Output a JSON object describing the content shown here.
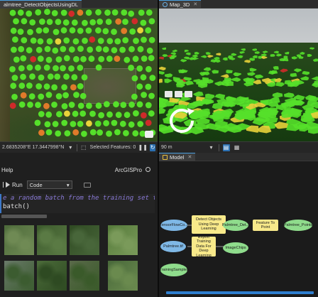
{
  "left_map": {
    "tab_title": "almtree_DetectObjectsUsingDL",
    "status": {
      "coordinates": "2.6835208°E 17.3447998°N",
      "selected_label": "Selected Features: 0"
    }
  },
  "map3d": {
    "tab_title": "Map_3D",
    "scale_value": "90 m"
  },
  "notebook": {
    "header_left": "Help",
    "kernel_label": "ArcGISPro",
    "run_label": "Run",
    "cell_type": "Code",
    "code_line1": "e a random batch from the training set to m",
    "code_line2": "batch()"
  },
  "model": {
    "tab_title": "Model",
    "nodes": {
      "tensorflow": "TensorFlowCo...",
      "detect": "Detect Objects Using Deep Learning",
      "palmtree_det": "Palmtree_Det...",
      "feature_to_point": "Feature To Point",
      "palmtree_points": "Palmtree_Points",
      "palmtree_tif": "Palmtree.tif",
      "export": "Export Training Data For Deep Learning",
      "image_chips": "ImageChips",
      "training_samples": "TrainingSamples"
    }
  },
  "colors": {
    "accent": "#3c78c8",
    "palm_green": "#55e02a",
    "palm_yellow": "#e8d23a",
    "palm_orange": "#e07a2a",
    "palm_red": "#d02a2a"
  }
}
